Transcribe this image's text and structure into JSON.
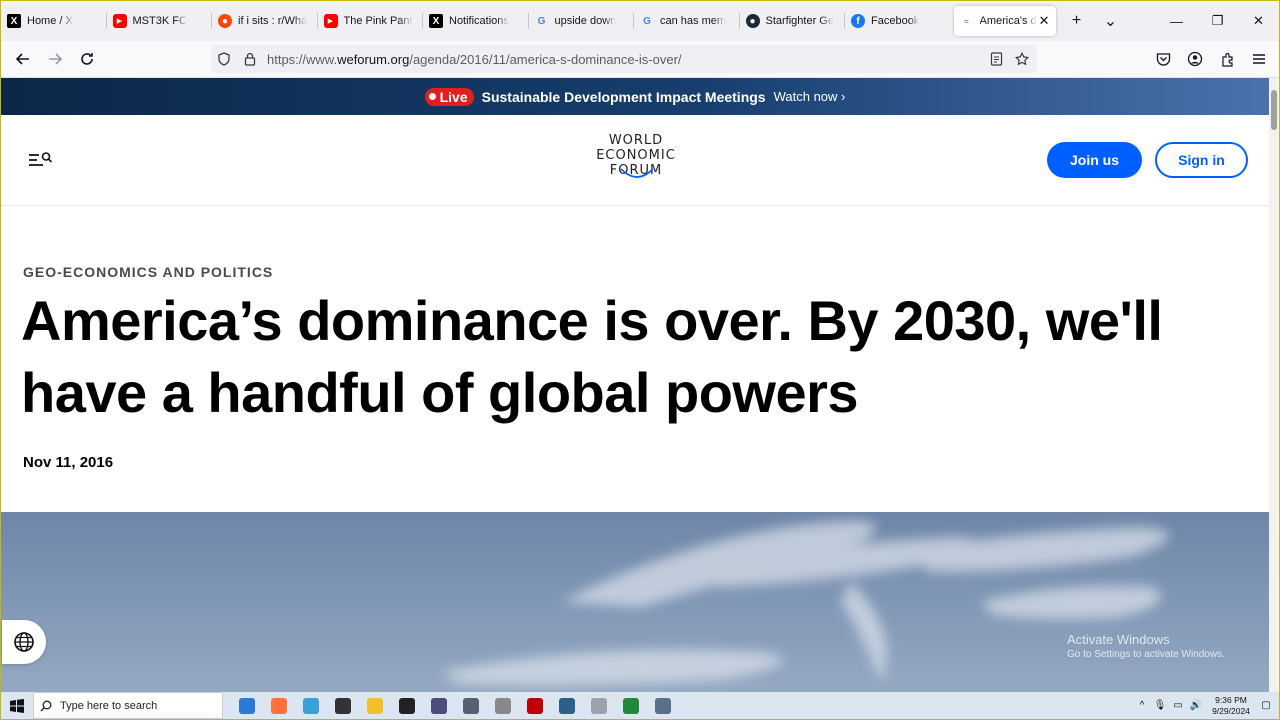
{
  "browser": {
    "tabs": [
      {
        "label": "Home / X",
        "icon": "x-logo-icon",
        "icon_glyph": "X",
        "cls": "fav-x"
      },
      {
        "label": "MST3K FC",
        "icon": "youtube-icon",
        "icon_glyph": "▶",
        "cls": "fav-yt"
      },
      {
        "label": "if i sits : r/Wha",
        "icon": "reddit-icon",
        "icon_glyph": "●",
        "cls": "fav-rd"
      },
      {
        "label": "The Pink Pant",
        "icon": "youtube-icon",
        "icon_glyph": "▶",
        "cls": "fav-yt"
      },
      {
        "label": "Notifications",
        "icon": "x-logo-icon",
        "icon_glyph": "X",
        "cls": "fav-x"
      },
      {
        "label": "upside down",
        "icon": "google-icon",
        "icon_glyph": "G",
        "cls": "fav-g"
      },
      {
        "label": "can has mem",
        "icon": "google-icon",
        "icon_glyph": "G",
        "cls": "fav-g"
      },
      {
        "label": "Starfighter Ge",
        "icon": "steam-icon",
        "icon_glyph": "●",
        "cls": "fav-st"
      },
      {
        "label": "Facebook",
        "icon": "facebook-icon",
        "icon_glyph": "f",
        "cls": "fav-fb"
      }
    ],
    "active_tab": {
      "label": "America's d",
      "close": "✕"
    },
    "new_tab": "+",
    "tab_list": "⌄",
    "window": {
      "minimize": "—",
      "maximize": "❐",
      "close": "✕"
    },
    "url": {
      "prefix": "https://www.",
      "domain": "weforum.org",
      "path": "/agenda/2016/11/america-s-dominance-is-over/"
    }
  },
  "site": {
    "live_banner": {
      "pill": "Live",
      "text": "Sustainable Development Impact Meetings",
      "link": "Watch now"
    },
    "logo": {
      "line1": "WORLD",
      "line2": "ECONOMIC",
      "line3": "FORUM"
    },
    "join_label": "Join us",
    "sign_in_label": "Sign in",
    "category": "GEO-ECONOMICS AND POLITICS",
    "headline": "America’s dominance is over. By 2030, we'll have a handful of global powers",
    "date": "Nov 11, 2016",
    "activate": {
      "title": "Activate Windows",
      "subtitle": "Go to Settings to activate Windows."
    }
  },
  "taskbar": {
    "search_placeholder": "Type here to search",
    "apps": [
      "#2a7bd4",
      "#ff7139",
      "#3aa0d8",
      "#333333",
      "#f3c02b",
      "#222222",
      "#4d4d7a",
      "#556070",
      "#888888",
      "#c00000",
      "#2c5f8a",
      "#9aa3ad",
      "#1f8a3a",
      "#5a6f8a"
    ],
    "time": "9:36 PM",
    "date": "9/29/2024"
  },
  "colors": {
    "accent": "#0060ff",
    "live_red": "#e0201f"
  }
}
